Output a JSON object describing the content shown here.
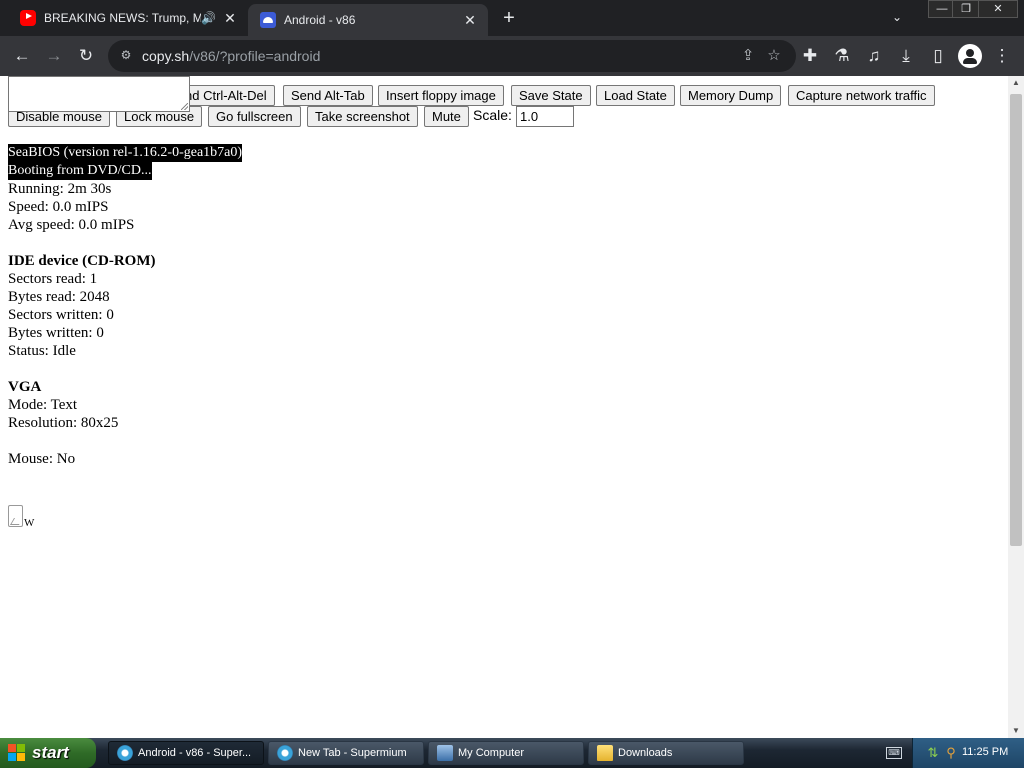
{
  "tabs": [
    {
      "title": "BREAKING NEWS: Trump, Mac",
      "favicon": "youtube-icon",
      "audio_icon": "speaker-icon",
      "close": "✕"
    },
    {
      "title": "Android - v86",
      "favicon": "android-v86-icon",
      "close": "✕"
    }
  ],
  "tabstrip": {
    "new_tab": "+",
    "tab_search": "⌄"
  },
  "window_controls": {
    "minimize": "—",
    "restore": "❐",
    "close": "✕"
  },
  "toolbar": {
    "back": "←",
    "forward": "→",
    "reload": "↻",
    "url_domain": "copy.sh",
    "url_path": "/v86/?profile=android",
    "share_icon": "⇪",
    "bookmark_icon": "☆",
    "extensions_icon": "✚",
    "labs_icon": "⚗",
    "media_icon": "♫",
    "download_icon": "⤓",
    "sidepanel_icon": "▯",
    "menu_icon": "⋮"
  },
  "controls": {
    "buttons": [
      {
        "name": "send-ctrl-alt-del-button",
        "label": "nd Ctrl-Alt-Del"
      },
      {
        "name": "send-alt-tab-button",
        "label": "Send Alt-Tab"
      },
      {
        "name": "insert-floppy-button",
        "label": "Insert floppy image"
      },
      {
        "name": "save-state-button",
        "label": "Save State"
      },
      {
        "name": "load-state-button",
        "label": "Load State"
      },
      {
        "name": "memory-dump-button",
        "label": "Memory Dump"
      },
      {
        "name": "capture-network-button",
        "label": "Capture network traffic"
      },
      {
        "name": "disable-mouse-button",
        "label": "Disable mouse"
      },
      {
        "name": "lock-mouse-button",
        "label": "Lock mouse"
      },
      {
        "name": "go-fullscreen-button",
        "label": "Go fullscreen"
      },
      {
        "name": "take-screenshot-button",
        "label": "Take screenshot"
      },
      {
        "name": "mute-button",
        "label": "Mute"
      }
    ],
    "scale_label": "Scale:",
    "scale_value": "1.0"
  },
  "terminal": {
    "line1": "SeaBIOS (version rel-1.16.2-0-gea1b7a0)",
    "line2": "Booting from DVD/CD..."
  },
  "stats": {
    "running": "Running: 2m 30s",
    "speed": "Speed: 0.0 mIPS",
    "avg_speed": "Avg speed: 0.0 mIPS"
  },
  "ide": {
    "heading": "IDE device (CD-ROM)",
    "sectors_read": "Sectors read: 1",
    "bytes_read": "Bytes read: 2048",
    "sectors_written": "Sectors written: 0",
    "bytes_written": "Bytes written: 0",
    "status": "Status: Idle"
  },
  "vga": {
    "heading": "VGA",
    "mode": "Mode: Text",
    "resolution": "Resolution: 80x25"
  },
  "mouse": {
    "status": "Mouse: No"
  },
  "broken_image_alt": "W",
  "taskbar": {
    "start_label": "start",
    "tasks": [
      {
        "label": "Android - v86 - Super...",
        "icon": "browser-icon",
        "active": true
      },
      {
        "label": "New Tab - Supermium",
        "icon": "browser-icon",
        "active": false
      },
      {
        "label": "My Computer",
        "icon": "computer-icon",
        "active": false
      },
      {
        "label": "Downloads",
        "icon": "folder-icon",
        "active": false
      }
    ],
    "clock": "11:25 PM"
  }
}
